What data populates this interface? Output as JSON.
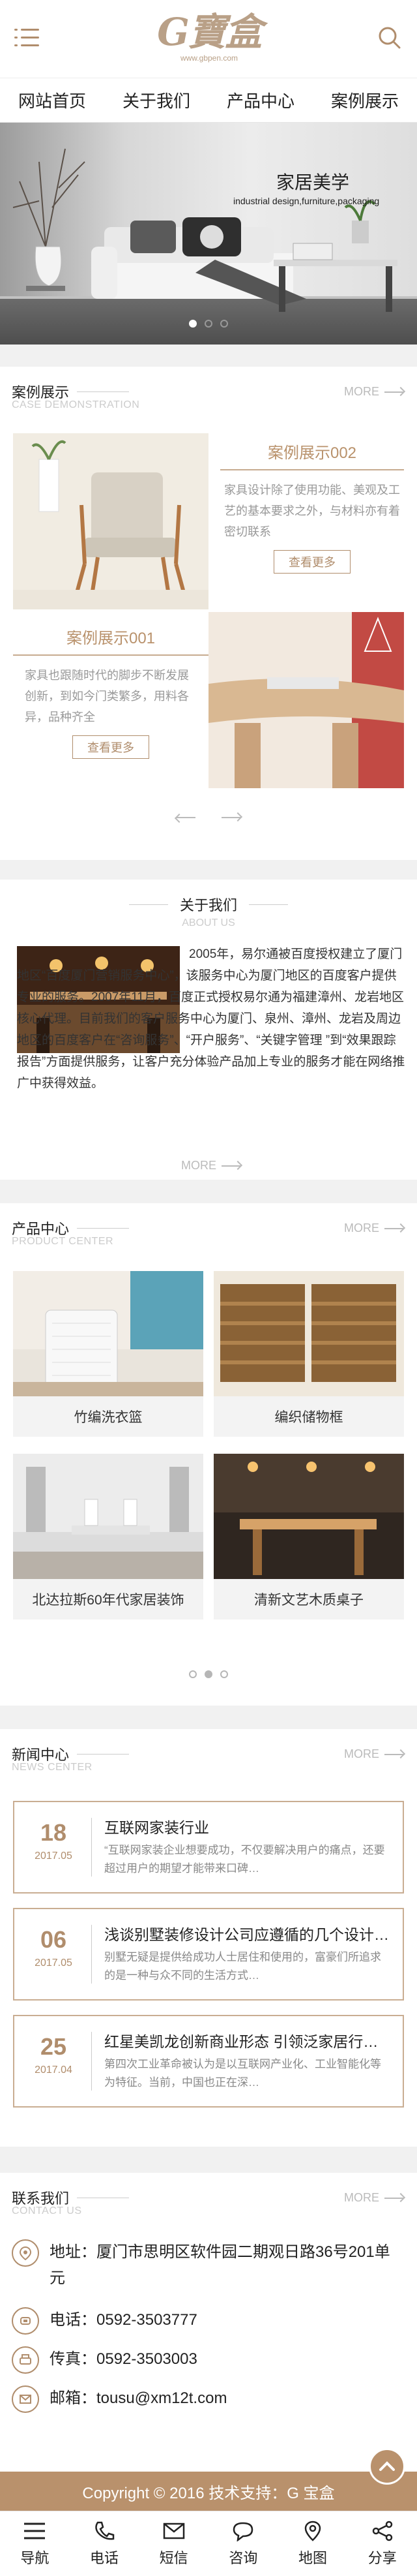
{
  "header": {
    "logo_text": "G寶盒",
    "logo_url": "www.gbpen.com"
  },
  "nav": [
    {
      "label": "网站首页"
    },
    {
      "label": "关于我们"
    },
    {
      "label": "产品中心"
    },
    {
      "label": "案例展示"
    }
  ],
  "banner": {
    "title": "家居美学",
    "subtitle": "industrial design,furniture,packaging",
    "slide_count": 3,
    "active_slide": 0
  },
  "cases": {
    "title": "案例展示",
    "subtitle": "CASE DEMONSTRATION",
    "more": "MORE",
    "items": [
      {
        "title": "案例展示002",
        "desc": "家具设计除了使用功能、美观及工艺的基本要求之外，与材料亦有着密切联系",
        "btn": "查看更多"
      },
      {
        "title": "案例展示001",
        "desc": "家具也跟随时代的脚步不断发展创新，到如今门类繁多，用料各异，品种齐全",
        "btn": "查看更多"
      }
    ]
  },
  "about": {
    "title": "关于我们",
    "subtitle": "ABOUT US",
    "text": "2005年，易尔通被百度授权建立了厦门地区“百度厦门营销服务中心”，该服务中心为厦门地区的百度客户提供专业的服务。2007年11月，百度正式授权易尔通为福建漳州、龙岩地区核心代理。目前我们的客户服务中心为厦门、泉州、漳州、龙岩及周边地区的百度客户在“咨询服务”、“开户服务”、“关键字管理 ”到“效果跟踪报告”方面提供服务，让客户充分体验产品加上专业的服务才能在网络推广中获得效益。",
    "more": "MORE"
  },
  "products": {
    "title": "产品中心",
    "subtitle": "PRODUCT CENTER",
    "more": "MORE",
    "items": [
      {
        "name": "竹编洗衣篮"
      },
      {
        "name": "编织储物框"
      },
      {
        "name": "北达拉斯60年代家居装饰"
      },
      {
        "name": "清新文艺木质桌子"
      }
    ],
    "page_count": 3,
    "active_page": 1
  },
  "news": {
    "title": "新闻中心",
    "subtitle": "NEWS CENTER",
    "more": "MORE",
    "items": [
      {
        "day": "18",
        "ym": "2017.05",
        "title": "互联网家装行业",
        "desc": "“互联网家装企业想要成功，不仅要解决用户的痛点，还要超过用户的期望才能带来口碑…"
      },
      {
        "day": "06",
        "ym": "2017.05",
        "title": "浅谈别墅装修设计公司应遵循的几个设计原则",
        "desc": "别墅无疑是提供给成功人士居住和使用的，富豪们所追求的是一种与众不同的生活方式…"
      },
      {
        "day": "25",
        "ym": "2017.04",
        "title": "红星美凯龙创新商业形态 引领泛家居行业发展",
        "desc": "第四次工业革命被认为是以互联网产业化、工业智能化等为特征。当前，中国也正在深…"
      }
    ]
  },
  "contact": {
    "title": "联系我们",
    "subtitle": "CONTACT US",
    "more": "MORE",
    "address": "地址：厦门市思明区软件园二期观日路36号201单元",
    "phone": "电话：0592-3503777",
    "fax": "传真：0592-3503003",
    "email": "邮箱：tousu@xm12t.com"
  },
  "footer": {
    "copyright": "Copyright © 2016  技术支持：G 宝盒"
  },
  "bottom_bar": [
    {
      "label": "导航",
      "icon": "menu-icon"
    },
    {
      "label": "电话",
      "icon": "phone-icon"
    },
    {
      "label": "短信",
      "icon": "mail-icon"
    },
    {
      "label": "咨询",
      "icon": "chat-icon"
    },
    {
      "label": "地图",
      "icon": "map-pin-icon"
    },
    {
      "label": "分享",
      "icon": "share-icon"
    }
  ],
  "colors": {
    "accent": "#b9916c",
    "accent_dark": "#b08d6c",
    "muted": "#cccccc"
  }
}
